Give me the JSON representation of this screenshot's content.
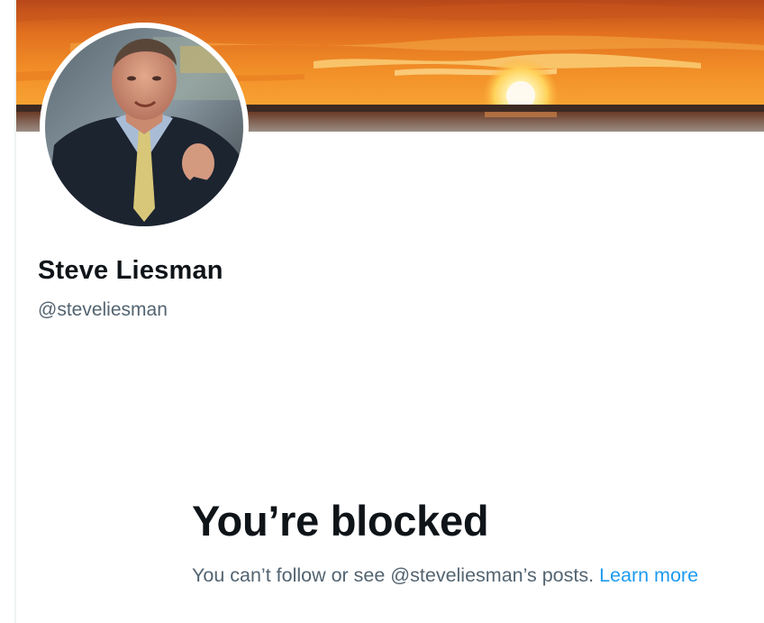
{
  "profile": {
    "display_name": "Steve Liesman",
    "handle": "@steveliesman"
  },
  "blocked_notice": {
    "title": "You’re blocked",
    "message": "You can’t follow or see @steveliesman’s posts.",
    "learn_more_label": "Learn more"
  },
  "colors": {
    "text_primary": "#0f1419",
    "text_secondary": "#536471",
    "link": "#1d9bf0"
  },
  "icons": {
    "banner": "sunset-banner-image",
    "avatar": "profile-photo"
  }
}
